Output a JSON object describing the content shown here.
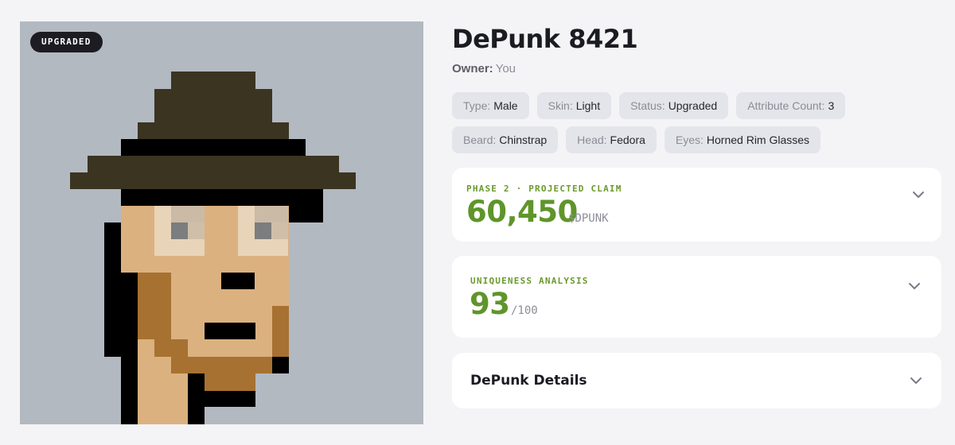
{
  "badge": "UPGRADED",
  "title": "DePunk 8421",
  "owner": {
    "label": "Owner:",
    "value": "You"
  },
  "attributes_row1": [
    {
      "key": "Type:",
      "value": "Male"
    },
    {
      "key": "Skin:",
      "value": "Light"
    },
    {
      "key": "Status:",
      "value": "Upgraded"
    },
    {
      "key": "Attribute Count:",
      "value": "3"
    }
  ],
  "attributes_row2": [
    {
      "key": "Beard:",
      "value": "Chinstrap"
    },
    {
      "key": "Head:",
      "value": "Fedora"
    },
    {
      "key": "Eyes:",
      "value": "Horned Rim Glasses"
    }
  ],
  "claim": {
    "eyebrow": "PHASE 2 · PROJECTED CLAIM",
    "value": "60,450",
    "unit": "$DPUNK"
  },
  "uniqueness": {
    "eyebrow": "UNIQUENESS ANALYSIS",
    "value": "93",
    "unit": "/100"
  },
  "details": {
    "title": "DePunk Details"
  },
  "icons": {
    "expand": "chevron-down-icon"
  },
  "colors": {
    "accent_green": "#5f952a",
    "art_background": "#b3b9c1",
    "badge_bg": "#1c1c22",
    "hat": "#3b3420",
    "skin": "#dbb180",
    "beard": "#a77131"
  }
}
